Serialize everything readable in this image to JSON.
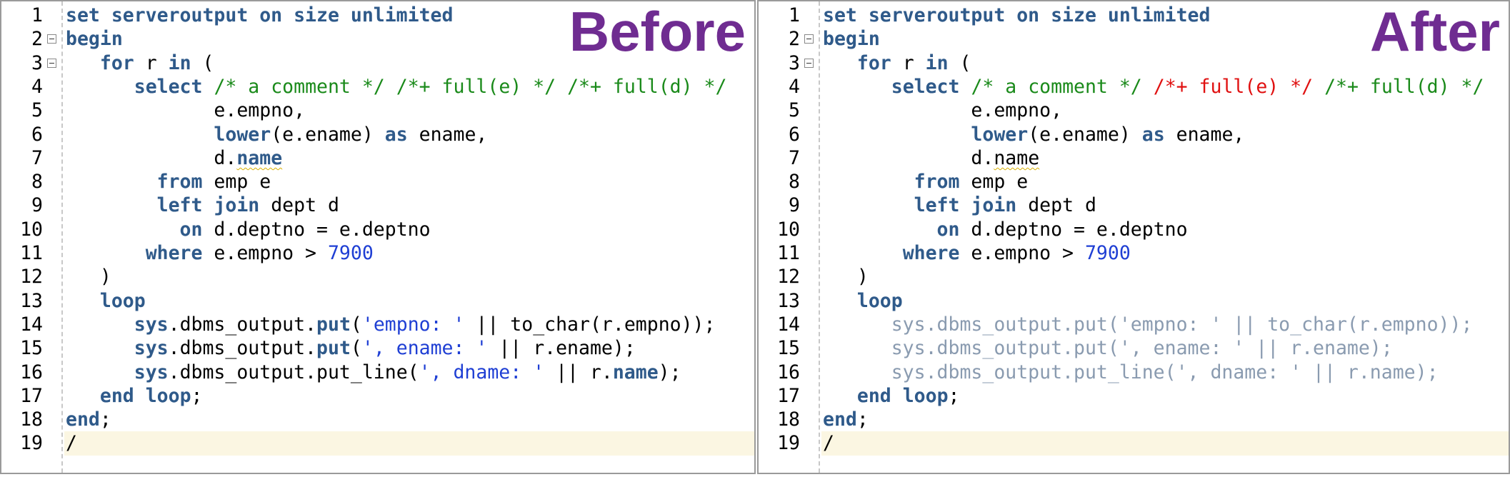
{
  "labels": {
    "before": "Before",
    "after": "After"
  },
  "colors": {
    "keyword": "#2f5a8a",
    "comment": "#1a8a1a",
    "string": "#1f3fd4",
    "ignored_hint": "#e01010",
    "dimmed_code": "#8a9bb0",
    "badge": "#6f2c91",
    "current_line": "#fbf6e2"
  },
  "line_numbers": [
    "1",
    "2",
    "3",
    "4",
    "5",
    "6",
    "7",
    "8",
    "9",
    "10",
    "11",
    "12",
    "13",
    "14",
    "15",
    "16",
    "17",
    "18",
    "19"
  ],
  "fold_markers_on_lines": [
    2,
    3
  ],
  "current_line": 19,
  "before": {
    "lines": [
      [
        {
          "t": "set serveroutput on size unlimited",
          "c": "kw"
        }
      ],
      [
        {
          "t": "begin",
          "c": "kw"
        }
      ],
      [
        {
          "t": "   "
        },
        {
          "t": "for",
          "c": "kw"
        },
        {
          "t": " r "
        },
        {
          "t": "in",
          "c": "kw"
        },
        {
          "t": " ("
        }
      ],
      [
        {
          "t": "      "
        },
        {
          "t": "select",
          "c": "kw"
        },
        {
          "t": " "
        },
        {
          "t": "/* a comment */",
          "c": "cm"
        },
        {
          "t": " "
        },
        {
          "t": "/*+ full(e) */",
          "c": "cm"
        },
        {
          "t": " "
        },
        {
          "t": "/*+ full(d) */",
          "c": "cm"
        }
      ],
      [
        {
          "t": "             e.empno,"
        }
      ],
      [
        {
          "t": "             "
        },
        {
          "t": "lower",
          "c": "kw"
        },
        {
          "t": "(e.ename) "
        },
        {
          "t": "as",
          "c": "kw"
        },
        {
          "t": " ename,"
        }
      ],
      [
        {
          "t": "             d."
        },
        {
          "t": "name",
          "c": "kw squig"
        }
      ],
      [
        {
          "t": "        "
        },
        {
          "t": "from",
          "c": "kw"
        },
        {
          "t": " emp e"
        }
      ],
      [
        {
          "t": "        "
        },
        {
          "t": "left",
          "c": "kw"
        },
        {
          "t": " "
        },
        {
          "t": "join",
          "c": "kw"
        },
        {
          "t": " dept d"
        }
      ],
      [
        {
          "t": "          "
        },
        {
          "t": "on",
          "c": "kw"
        },
        {
          "t": " d.deptno = e.deptno"
        }
      ],
      [
        {
          "t": "       "
        },
        {
          "t": "where",
          "c": "kw"
        },
        {
          "t": " e.empno > "
        },
        {
          "t": "7900",
          "c": "num"
        }
      ],
      [
        {
          "t": "   )"
        }
      ],
      [
        {
          "t": "   "
        },
        {
          "t": "loop",
          "c": "kw"
        }
      ],
      [
        {
          "t": "      "
        },
        {
          "t": "sys",
          "c": "kw"
        },
        {
          "t": ".dbms_output."
        },
        {
          "t": "put",
          "c": "kw"
        },
        {
          "t": "("
        },
        {
          "t": "'empno: '",
          "c": "str"
        },
        {
          "t": " || to_char(r.empno));"
        }
      ],
      [
        {
          "t": "      "
        },
        {
          "t": "sys",
          "c": "kw"
        },
        {
          "t": ".dbms_output."
        },
        {
          "t": "put",
          "c": "kw"
        },
        {
          "t": "("
        },
        {
          "t": "', ename: '",
          "c": "str"
        },
        {
          "t": " || r.ename);"
        }
      ],
      [
        {
          "t": "      "
        },
        {
          "t": "sys",
          "c": "kw"
        },
        {
          "t": ".dbms_output.put_line("
        },
        {
          "t": "', dname: '",
          "c": "str"
        },
        {
          "t": " || r."
        },
        {
          "t": "name",
          "c": "kw"
        },
        {
          "t": ");"
        }
      ],
      [
        {
          "t": "   "
        },
        {
          "t": "end",
          "c": "kw"
        },
        {
          "t": " "
        },
        {
          "t": "loop",
          "c": "kw"
        },
        {
          "t": ";"
        }
      ],
      [
        {
          "t": "end",
          "c": "kw"
        },
        {
          "t": ";"
        }
      ],
      [
        {
          "t": "/"
        }
      ]
    ]
  },
  "after": {
    "lines": [
      [
        {
          "t": "set serveroutput on size unlimited",
          "c": "kw"
        }
      ],
      [
        {
          "t": "begin",
          "c": "kw"
        }
      ],
      [
        {
          "t": "   "
        },
        {
          "t": "for",
          "c": "kw"
        },
        {
          "t": " r "
        },
        {
          "t": "in",
          "c": "kw"
        },
        {
          "t": " ("
        }
      ],
      [
        {
          "t": "      "
        },
        {
          "t": "select",
          "c": "kw"
        },
        {
          "t": " "
        },
        {
          "t": "/* a comment */",
          "c": "cm"
        },
        {
          "t": " "
        },
        {
          "t": "/*+ full(e) */",
          "c": "hint-red"
        },
        {
          "t": " "
        },
        {
          "t": "/*+ full(d) */",
          "c": "cm"
        }
      ],
      [
        {
          "t": "             e.empno,"
        }
      ],
      [
        {
          "t": "             "
        },
        {
          "t": "lower",
          "c": "kw"
        },
        {
          "t": "(e.ename) "
        },
        {
          "t": "as",
          "c": "kw"
        },
        {
          "t": " ename,"
        }
      ],
      [
        {
          "t": "             d."
        },
        {
          "t": "name",
          "c": "squig"
        }
      ],
      [
        {
          "t": "        "
        },
        {
          "t": "from",
          "c": "kw"
        },
        {
          "t": " emp e"
        }
      ],
      [
        {
          "t": "        "
        },
        {
          "t": "left",
          "c": "kw"
        },
        {
          "t": " "
        },
        {
          "t": "join",
          "c": "kw"
        },
        {
          "t": " dept d"
        }
      ],
      [
        {
          "t": "          "
        },
        {
          "t": "on",
          "c": "kw"
        },
        {
          "t": " d.deptno = e.deptno"
        }
      ],
      [
        {
          "t": "       "
        },
        {
          "t": "where",
          "c": "kw"
        },
        {
          "t": " e.empno > "
        },
        {
          "t": "7900",
          "c": "num"
        }
      ],
      [
        {
          "t": "   )"
        }
      ],
      [
        {
          "t": "   "
        },
        {
          "t": "loop",
          "c": "kw"
        }
      ],
      [
        {
          "t": "      sys.dbms_output.put('empno: ' || to_char(r.empno));",
          "c": "dim"
        }
      ],
      [
        {
          "t": "      sys.dbms_output.put(', ename: ' || r.ename);",
          "c": "dim"
        }
      ],
      [
        {
          "t": "      sys.dbms_output.put_line(', dname: ' || r.name);",
          "c": "dim"
        }
      ],
      [
        {
          "t": "   "
        },
        {
          "t": "end",
          "c": "kw"
        },
        {
          "t": " "
        },
        {
          "t": "loop",
          "c": "kw"
        },
        {
          "t": ";"
        }
      ],
      [
        {
          "t": "end",
          "c": "kw"
        },
        {
          "t": ";"
        }
      ],
      [
        {
          "t": "/"
        }
      ]
    ]
  }
}
